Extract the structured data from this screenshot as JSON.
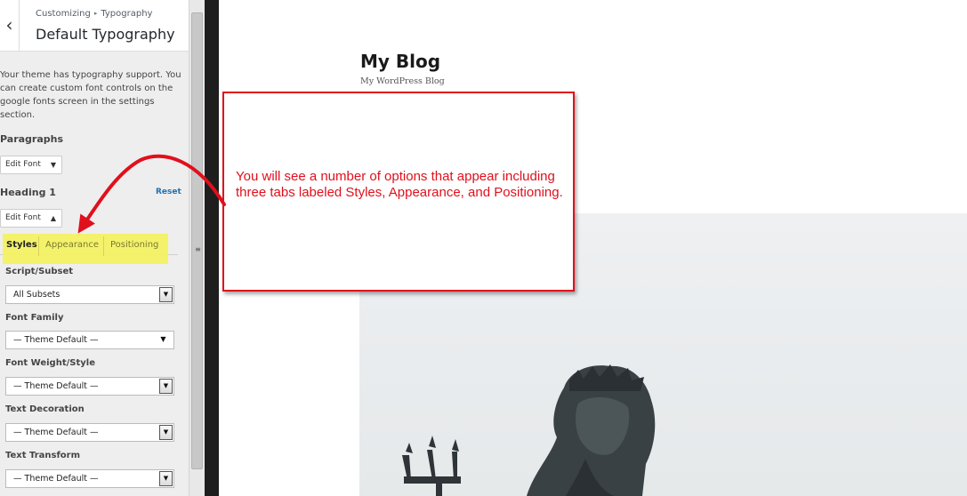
{
  "sidebar": {
    "back_icon": "chevron-left-icon",
    "breadcrumb": {
      "parent": "Customizing",
      "separator": "▸",
      "current": "Typography"
    },
    "panel_title": "Default Typography",
    "description": "Your theme has typography support. You can create custom font controls on the google fonts screen in the settings section.",
    "paragraphs": {
      "label": "Paragraphs",
      "edit_font": "Edit Font",
      "caret": "▼"
    },
    "heading1": {
      "label": "Heading 1",
      "reset": "Reset",
      "edit_font": "Edit Font",
      "caret": "▲"
    },
    "tabs": [
      {
        "label": "Styles",
        "active": true
      },
      {
        "label": "Appearance",
        "active": false
      },
      {
        "label": "Positioning",
        "active": false
      }
    ],
    "fields": [
      {
        "label": "Script/Subset",
        "value": "All Subsets"
      },
      {
        "label": "Font Family",
        "value": "— Theme Default —"
      },
      {
        "label": "Font Weight/Style",
        "value": "— Theme Default —"
      },
      {
        "label": "Text Decoration",
        "value": "— Theme Default —"
      },
      {
        "label": "Text Transform",
        "value": "— Theme Default —"
      }
    ],
    "highlight_color": "#f4f25c"
  },
  "preview": {
    "site_title": "My Blog",
    "tagline": "My WordPress Blog",
    "hero_image": "statue-of-neptune-with-trident"
  },
  "annotation": {
    "text": "You will see a number of options that appear including three tabs labeled Styles, Appearance, and Positioning.",
    "color": "#e0101c",
    "arrow": "curved-arrow-icon"
  }
}
